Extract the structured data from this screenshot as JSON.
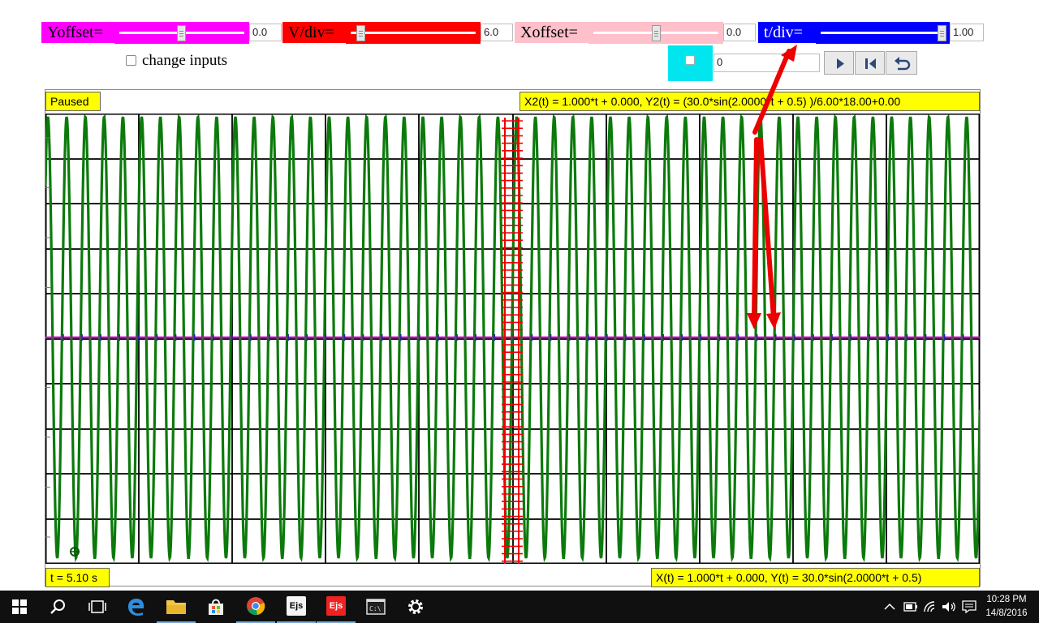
{
  "controls": {
    "yoffset": {
      "label": "Yoffset=",
      "value": "0.0",
      "color": "#ff00ff"
    },
    "vdiv": {
      "label": "V/div=",
      "value": "6.0",
      "color": "#ff0000"
    },
    "xoffset": {
      "label": "Xoffset=",
      "value": "0.0",
      "color": "#ffc0cb"
    },
    "tdiv": {
      "label": "t/div=",
      "value": "1.00",
      "color": "#0000ff"
    },
    "change_inputs_label": "change inputs",
    "step_field_value": "0",
    "step_button_color": "#00e5ee"
  },
  "plot": {
    "status": "Paused",
    "time_label": "t = 5.10 s",
    "formula_top": "X2(t) = 1.000*t + 0.000, Y2(t) = (30.0*sin(2.0000*t + 0.5) )/6.00*18.00+0.00",
    "formula_bottom": "X(t) = 1.000*t + 0.000, Y(t) = 30.0*sin(2.0000*t + 0.5)",
    "wave_color": "#0b7a0b",
    "axis_color": "#c000c0",
    "marker_color": "#ee0000",
    "grid_color": "#000000"
  },
  "taskbar": {
    "items": [
      "start-icon",
      "search-icon",
      "task-view-icon",
      "edge-icon",
      "file-explorer-icon",
      "store-icon",
      "chrome-icon",
      "ejs-icon",
      "ejs-icon",
      "command-prompt-icon",
      "settings-icon"
    ],
    "ejs_text": "Ejs",
    "clock_time": "10:28 PM",
    "clock_date": "14/8/2016"
  }
}
